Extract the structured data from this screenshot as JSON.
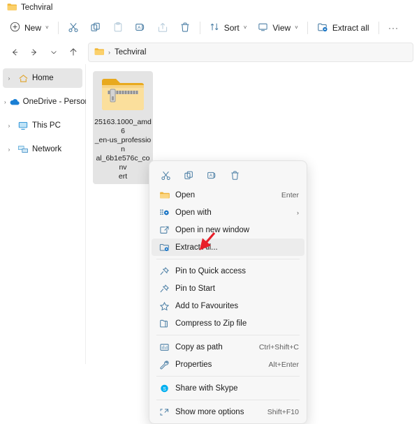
{
  "window": {
    "tab_label": "Techviral",
    "tab_icon": "folder-icon"
  },
  "toolbar": {
    "new_label": "New",
    "new_icon": "plus-circle-icon",
    "cut_icon": "scissors-icon",
    "copy_icon": "copy-icon",
    "paste_icon": "paste-icon",
    "rename_icon": "rename-icon",
    "share_icon": "share-icon",
    "delete_icon": "trash-icon",
    "sort_label": "Sort",
    "sort_icon": "sort-arrows-icon",
    "view_label": "View",
    "view_icon": "monitor-icon",
    "extract_all_label": "Extract all",
    "extract_all_icon": "extract-folder-icon",
    "more_label": "···",
    "chevron": "˅"
  },
  "navigation": {
    "back_icon": "arrow-left-icon",
    "forward_icon": "arrow-right-icon",
    "recent_icon": "chevron-down-icon",
    "up_icon": "arrow-up-icon",
    "address_folder_icon": "folder-icon",
    "address_separator": "›",
    "address_crumb": "Techviral"
  },
  "sidebar": {
    "items": [
      {
        "label": "Home",
        "icon": "home-icon",
        "selected": true
      },
      {
        "label": "OneDrive - Personal",
        "icon": "cloud-icon",
        "selected": false
      },
      {
        "label": "This PC",
        "icon": "monitor-icon",
        "selected": false
      },
      {
        "label": "Network",
        "icon": "network-icon",
        "selected": false
      }
    ],
    "expander": "›"
  },
  "files": {
    "items": [
      {
        "name": "25163.1000_amd6_en-us_professional_6b1e576c_convert",
        "name_lines": [
          "25163.1000_amd6",
          "_en-us_profession",
          "al_6b1e576c_conv",
          "ert"
        ],
        "icon": "zip-folder-icon",
        "selected": true
      }
    ]
  },
  "context_menu": {
    "tool_row": [
      {
        "icon": "scissors-icon",
        "name": "cut"
      },
      {
        "icon": "copy-icon",
        "name": "copy"
      },
      {
        "icon": "rename-icon",
        "name": "rename"
      },
      {
        "icon": "trash-icon",
        "name": "delete"
      }
    ],
    "items": [
      {
        "label": "Open",
        "icon": "folder-open-icon",
        "accel": "Enter",
        "submenu": false,
        "highlighted": false
      },
      {
        "label": "Open with",
        "icon": "open-with-icon",
        "accel": "",
        "submenu": true,
        "highlighted": false
      },
      {
        "label": "Open in new window",
        "icon": "new-window-icon",
        "accel": "",
        "submenu": false,
        "highlighted": false
      },
      {
        "label": "Extract All...",
        "icon": "extract-folder-icon",
        "accel": "",
        "submenu": false,
        "highlighted": true
      },
      {
        "label": "Pin to Quick access",
        "icon": "pin-icon",
        "accel": "",
        "submenu": false,
        "highlighted": false
      },
      {
        "label": "Pin to Start",
        "icon": "pin-icon",
        "accel": "",
        "submenu": false,
        "highlighted": false
      },
      {
        "label": "Add to Favourites",
        "icon": "star-icon",
        "accel": "",
        "submenu": false,
        "highlighted": false
      },
      {
        "label": "Compress to Zip file",
        "icon": "zip-icon",
        "accel": "",
        "submenu": false,
        "highlighted": false
      },
      {
        "label": "Copy as path",
        "icon": "copy-path-icon",
        "accel": "Ctrl+Shift+C",
        "submenu": false,
        "highlighted": false
      },
      {
        "label": "Properties",
        "icon": "wrench-icon",
        "accel": "Alt+Enter",
        "submenu": false,
        "highlighted": false
      },
      {
        "label": "Share with Skype",
        "icon": "skype-icon",
        "accel": "",
        "submenu": false,
        "highlighted": false
      },
      {
        "label": "Show more options",
        "icon": "more-options-icon",
        "accel": "Shift+F10",
        "submenu": false,
        "highlighted": false
      }
    ],
    "submenu_chevron": "›"
  },
  "annotation": {
    "arrow_color": "#e8202a",
    "points_at": "Extract All..."
  },
  "colors": {
    "accent_blue": "#4a8ec2",
    "folder_yellow": "#f5c242",
    "selection_grey": "#e4e4e4",
    "menu_bg": "#f7f7f7"
  }
}
